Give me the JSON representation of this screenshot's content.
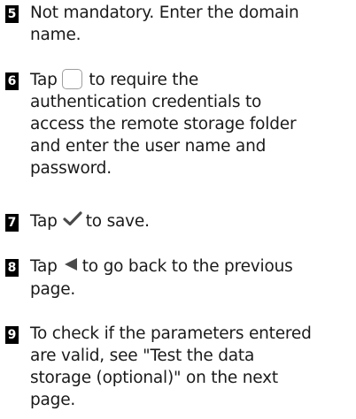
{
  "steps": [
    {
      "number": "5",
      "text": [
        "Not mandatory. Enter the domain",
        "name."
      ]
    },
    {
      "number": "6",
      "text_before_icon": "Tap",
      "icon": "checkbox-icon",
      "text_after_icon": "to require the",
      "text": [
        "authentication credentials to",
        "access the remote storage folder",
        "and enter the user name and",
        "password."
      ]
    },
    {
      "number": "7",
      "text_before_icon": "Tap",
      "icon": "check-icon",
      "icon_color": "#4a4a4a",
      "text_after_icon": "to save."
    },
    {
      "number": "8",
      "text_before_icon": "Tap",
      "icon": "back-triangle-icon",
      "icon_color": "#4a4a4a",
      "text_after_icon": "to go back to the previous",
      "text": [
        "page."
      ]
    },
    {
      "number": "9",
      "text": [
        "To check if the parameters entered",
        "are valid, see \"Test the data",
        "storage (optional)\" on the next",
        "page."
      ]
    }
  ]
}
